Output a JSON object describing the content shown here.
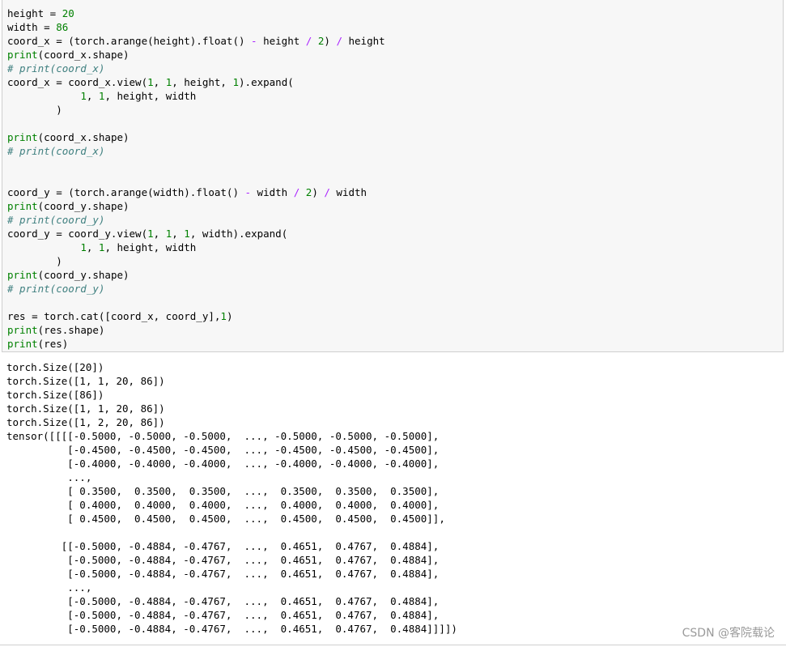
{
  "input_cell": {
    "lines": [
      [
        {
          "t": "height = ",
          "c": ""
        },
        {
          "t": "20",
          "c": "num"
        }
      ],
      [
        {
          "t": "width = ",
          "c": ""
        },
        {
          "t": "86",
          "c": "num"
        }
      ],
      [
        {
          "t": "coord_x = (torch.arange(height).float() ",
          "c": ""
        },
        {
          "t": "-",
          "c": "op"
        },
        {
          "t": " height ",
          "c": ""
        },
        {
          "t": "/",
          "c": "op"
        },
        {
          "t": " ",
          "c": ""
        },
        {
          "t": "2",
          "c": "num"
        },
        {
          "t": ") ",
          "c": ""
        },
        {
          "t": "/",
          "c": "op"
        },
        {
          "t": " height",
          "c": ""
        }
      ],
      [
        {
          "t": "print",
          "c": "kw-print"
        },
        {
          "t": "(coord_x.shape)",
          "c": ""
        }
      ],
      [
        {
          "t": "# print(coord_x)",
          "c": "cm"
        }
      ],
      [
        {
          "t": "coord_x = coord_x.view(",
          "c": ""
        },
        {
          "t": "1",
          "c": "num"
        },
        {
          "t": ", ",
          "c": ""
        },
        {
          "t": "1",
          "c": "num"
        },
        {
          "t": ", height, ",
          "c": ""
        },
        {
          "t": "1",
          "c": "num"
        },
        {
          "t": ").expand(",
          "c": ""
        }
      ],
      [
        {
          "t": "            ",
          "c": ""
        },
        {
          "t": "1",
          "c": "num"
        },
        {
          "t": ", ",
          "c": ""
        },
        {
          "t": "1",
          "c": "num"
        },
        {
          "t": ", height, width",
          "c": ""
        }
      ],
      [
        {
          "t": "        )",
          "c": ""
        }
      ],
      [],
      [
        {
          "t": "print",
          "c": "kw-print"
        },
        {
          "t": "(coord_x.shape)",
          "c": ""
        }
      ],
      [
        {
          "t": "# print(coord_x)",
          "c": "cm"
        }
      ],
      [],
      [],
      [
        {
          "t": "coord_y = (torch.arange(width).float() ",
          "c": ""
        },
        {
          "t": "-",
          "c": "op"
        },
        {
          "t": " width ",
          "c": ""
        },
        {
          "t": "/",
          "c": "op"
        },
        {
          "t": " ",
          "c": ""
        },
        {
          "t": "2",
          "c": "num"
        },
        {
          "t": ") ",
          "c": ""
        },
        {
          "t": "/",
          "c": "op"
        },
        {
          "t": " width",
          "c": ""
        }
      ],
      [
        {
          "t": "print",
          "c": "kw-print"
        },
        {
          "t": "(coord_y.shape)",
          "c": ""
        }
      ],
      [
        {
          "t": "# print(coord_y)",
          "c": "cm"
        }
      ],
      [
        {
          "t": "coord_y = coord_y.view(",
          "c": ""
        },
        {
          "t": "1",
          "c": "num"
        },
        {
          "t": ", ",
          "c": ""
        },
        {
          "t": "1",
          "c": "num"
        },
        {
          "t": ", ",
          "c": ""
        },
        {
          "t": "1",
          "c": "num"
        },
        {
          "t": ", width).expand(",
          "c": ""
        }
      ],
      [
        {
          "t": "            ",
          "c": ""
        },
        {
          "t": "1",
          "c": "num"
        },
        {
          "t": ", ",
          "c": ""
        },
        {
          "t": "1",
          "c": "num"
        },
        {
          "t": ", height, width",
          "c": ""
        }
      ],
      [
        {
          "t": "        )",
          "c": ""
        }
      ],
      [
        {
          "t": "print",
          "c": "kw-print"
        },
        {
          "t": "(coord_y.shape)",
          "c": ""
        }
      ],
      [
        {
          "t": "# print(coord_y)",
          "c": "cm"
        }
      ],
      [],
      [
        {
          "t": "res = torch.cat([coord_x, coord_y],",
          "c": ""
        },
        {
          "t": "1",
          "c": "num"
        },
        {
          "t": ")",
          "c": ""
        }
      ],
      [
        {
          "t": "print",
          "c": "kw-print"
        },
        {
          "t": "(res.shape)",
          "c": ""
        }
      ],
      [
        {
          "t": "print",
          "c": "kw-print"
        },
        {
          "t": "(res)",
          "c": ""
        }
      ]
    ]
  },
  "output_cell": {
    "lines": [
      "torch.Size([20])",
      "torch.Size([1, 1, 20, 86])",
      "torch.Size([86])",
      "torch.Size([1, 1, 20, 86])",
      "torch.Size([1, 2, 20, 86])",
      "tensor([[[[-0.5000, -0.5000, -0.5000,  ..., -0.5000, -0.5000, -0.5000],",
      "          [-0.4500, -0.4500, -0.4500,  ..., -0.4500, -0.4500, -0.4500],",
      "          [-0.4000, -0.4000, -0.4000,  ..., -0.4000, -0.4000, -0.4000],",
      "          ...,",
      "          [ 0.3500,  0.3500,  0.3500,  ...,  0.3500,  0.3500,  0.3500],",
      "          [ 0.4000,  0.4000,  0.4000,  ...,  0.4000,  0.4000,  0.4000],",
      "          [ 0.4500,  0.4500,  0.4500,  ...,  0.4500,  0.4500,  0.4500]],",
      "",
      "         [[-0.5000, -0.4884, -0.4767,  ...,  0.4651,  0.4767,  0.4884],",
      "          [-0.5000, -0.4884, -0.4767,  ...,  0.4651,  0.4767,  0.4884],",
      "          [-0.5000, -0.4884, -0.4767,  ...,  0.4651,  0.4767,  0.4884],",
      "          ...,",
      "          [-0.5000, -0.4884, -0.4767,  ...,  0.4651,  0.4767,  0.4884],",
      "          [-0.5000, -0.4884, -0.4767,  ...,  0.4651,  0.4767,  0.4884],",
      "          [-0.5000, -0.4884, -0.4767,  ...,  0.4651,  0.4767,  0.4884]]]])"
    ]
  },
  "watermark": "CSDN @客院载论",
  "colors": {
    "input_background": "#f7f7f7",
    "builtin_print": "#008000",
    "number": "#008000",
    "operator": "#aa22ff",
    "comment": "#408080"
  }
}
